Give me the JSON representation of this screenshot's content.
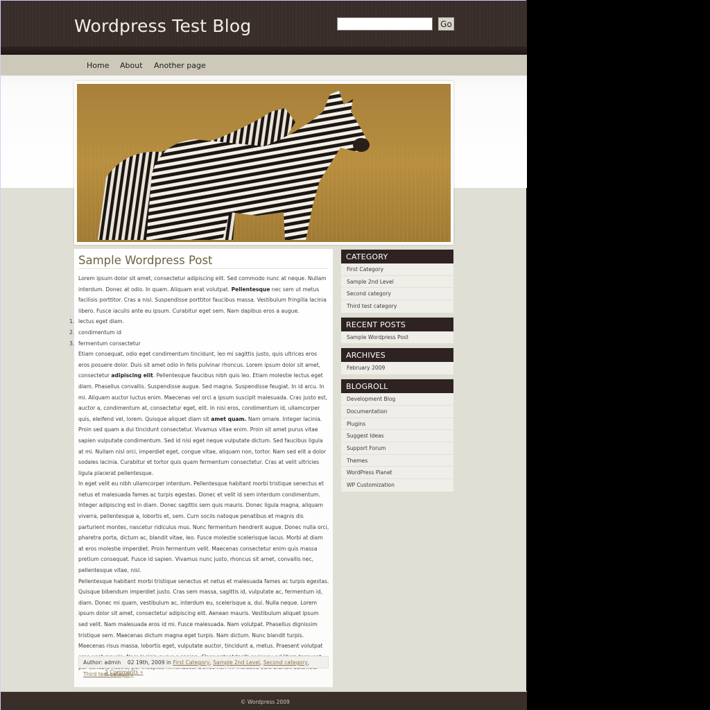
{
  "header": {
    "site_title": "Wordpress Test Blog",
    "search": {
      "value": "",
      "placeholder": "",
      "button_label": "Go"
    }
  },
  "nav": {
    "items": [
      {
        "label": "Home"
      },
      {
        "label": "About"
      },
      {
        "label": "Another page"
      }
    ]
  },
  "banner": {
    "alt": "Two zebras standing in golden savanna grass"
  },
  "post": {
    "title": "Sample Wordpress Post",
    "p1_a": "Lorem ipsum dolor sit amet, consectetur adipiscing elit. Sed commodo nunc at neque. Nullam interdum. Donec at odio. In quam. Aliquam erat volutpat. ",
    "p1_bold": "Pellentesque",
    "p1_b": " nec sem ut metus facilisis porttitor. Cras a nisl. Suspendisse porttitor faucibus massa. Vestibulum fringilla lacinia libero. Fusce iaculis ante eu ipsum. Curabitur eget sem. Nam dapibus eros a augue.",
    "list": [
      {
        "num": "1.",
        "text": "lectus eget diam."
      },
      {
        "num": "2.",
        "text": "condimentum id"
      },
      {
        "num": "3.",
        "text": "fermentum consectetur"
      }
    ],
    "p2_a": "Etiam consequat, odio eget condimentum tincidunt, leo mi sagittis justo, quis ultrices eros eros posuere dolor. Duis sit amet odio in felis pulvinar rhoncus. Lorem ipsum dolor sit amet, consectetur ",
    "p2_bold1": "adipiscing elit",
    "p2_b": ". Pellentesque faucibus nibh quis leo. Etiam molestie lectus eget diam. Phasellus convallis. Suspendisse augue. Sed magna. Suspendisse feugiat. In id arcu. In mi. Aliquam auctor luctus enim. Maecenas vel orci a ipsum suscipit malesuada. Cras justo est, auctor a, condimentum at, consectetur eget, elit. In nisi eros, condimentum id, ullamcorper quis, eleifend vel, lorem. Quisque aliquet diam sit ",
    "p2_bold2": "amet quam.",
    "p2_c": " Nam ornare. Integer lacinia. Proin sed quam a dui tincidunt consectetur. Vivamus vitae enim. Proin sit amet purus vitae sapien vulputate condimentum. Sed id nisi eget neque vulputate dictum. Sed faucibus ligula at mi. Nullam nisl orci, imperdiet eget, congue vitae, aliquam non, tortor. Nam sed elit a dolor sodales lacinia. Curabitur et tortor quis quam fermentum consectetur. Cras at velit ultricies ligula placerat pellentesque.",
    "p3": "In eget velit eu nibh ullamcorper interdum. Pellentesque habitant morbi tristique senectus et netus et malesuada fames ac turpis egestas. Donec et velit id sem interdum condimentum. Integer adipiscing est in diam. Donec sagittis sem quis mauris. Donec ligula magna, aliquam viverra, pellentesque a, lobortis et, sem. Cum sociis natoque penatibus et magnis dis parturient montes, nascetur ridiculus mus. Nunc fermentum hendrerit augue. Donec nulla orci, pharetra porta, dictum ac, blandit vitae, leo. Fusce molestie scelerisque lacus. Morbi at diam at eros molestie imperdiet. Proin fermentum velit. Maecenas consectetur enim quis massa pretium consequat. Fusce id sapien. Vivamus nunc justo, rhoncus sit amet, convallis nec, pellentesque vitae, nisl.",
    "p4": "Pellentesque habitant morbi tristique senectus et netus et malesuada fames ac turpis egestas. Quisque bibendum imperdiet justo. Cras sem massa, sagittis id, vulputate ac, fermentum id, diam. Donec mi quam, vestibulum ac, interdum eu, scelerisque a, dui. Nulla neque. Lorem ipsum dolor sit amet, consectetur adipiscing elit. Aenean mauris. Vestibulum aliquet ipsum sed velit. Nam malesuada eros id mi. Fusce malesuada. Nam volutpat. Phasellus dignissim tristique sem. Maecenas dictum magna eget turpis. Nam dictum. Nunc blandit turpis. Maecenas risus massa, lobortis eget, vulputate auctor, tincidunt a, metus. Praesent volutpat eros eget mauris. Nam lacinia purus a sapien. Class aptent taciti sociosqu ad litora torquent per conubia nostra, per inceptos himenaeos. Donec non mi molestie odio blandit euismod.",
    "meta": {
      "author": "Author: admin",
      "date_prefix": "02 19th, 2009 in",
      "categories": [
        "First Category",
        "Sample 2nd Level",
        "Second category",
        "Third test category"
      ],
      "comments_link": "2 Comments »"
    }
  },
  "sidebar": {
    "widgets": [
      {
        "title": "CATEGORY",
        "items": [
          "First Category",
          "Sample 2nd Level",
          "Second category",
          "Third test category"
        ]
      },
      {
        "title": "RECENT POSTS",
        "items": [
          "Sample Wordpress Post"
        ]
      },
      {
        "title": "ARCHIVES",
        "items": [
          "February 2009"
        ]
      },
      {
        "title": "BLOGROLL",
        "items": [
          "Development Blog",
          "Documentation",
          "Plugins",
          "Suggest Ideas",
          "Support Forum",
          "Themes",
          "WordPress Planet",
          "WP Customization"
        ]
      }
    ]
  },
  "footer": {
    "text": "© Wordpress 2009"
  },
  "colors": {
    "header_bg": "#3a2e2b",
    "nav_bg": "#ccc9bb",
    "widget_title_bg": "#2e2321",
    "post_title": "#6b6440",
    "link": "#8a7550",
    "page_bg": "#e0dfd5"
  }
}
